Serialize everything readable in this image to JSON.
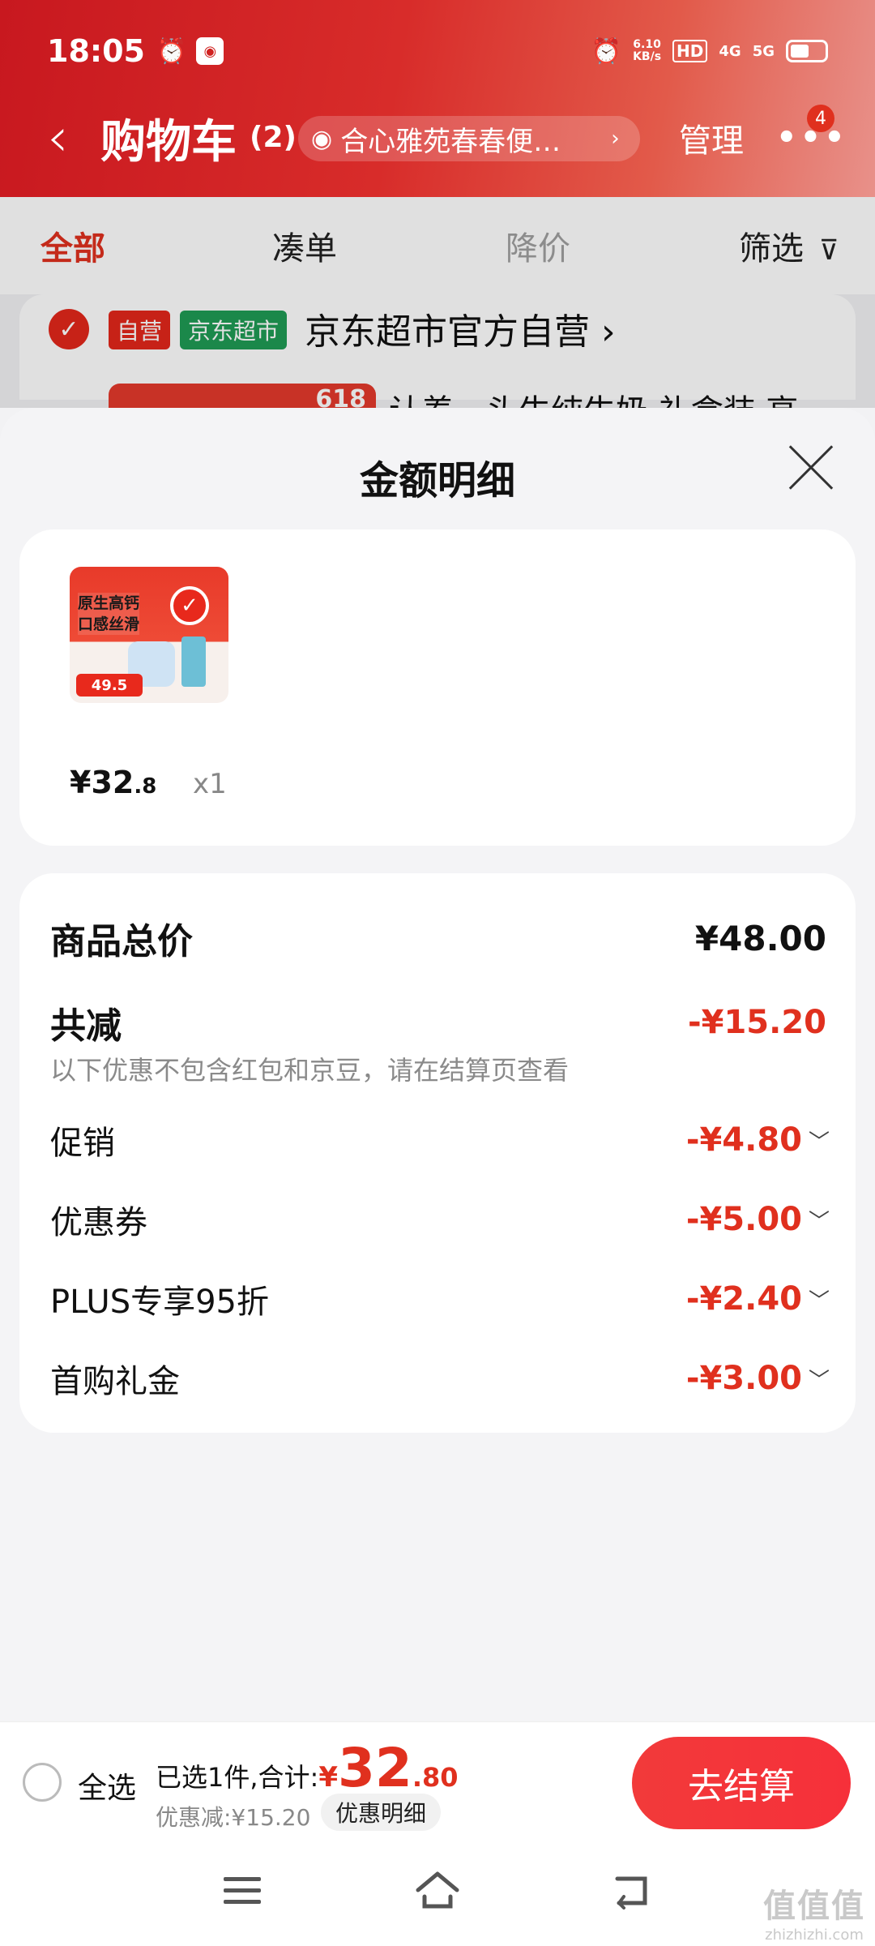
{
  "status_bar": {
    "time": "18:05",
    "net_speed": "6.10",
    "net_unit": "KB/s",
    "hd": "HD",
    "sig1": "4G",
    "sig2": "5G"
  },
  "header": {
    "title": "购物车",
    "count": "(2)",
    "address": "合心雅苑春春便…",
    "manage": "管理",
    "more_badge": "4"
  },
  "tabs": [
    "全部",
    "凑单",
    "降价",
    "筛选"
  ],
  "store": {
    "tag_self": "自营",
    "tag_market": "京东超市",
    "name": "京东超市官方自营",
    "product_title_partial": "认养一头牛纯牛奶 礼盒装 高",
    "product_badge": "618"
  },
  "sheet": {
    "title": "金额明细",
    "item": {
      "thumb_text": "原生高钙\n口感丝滑",
      "thumb_price": "49.5",
      "price_int": "¥32",
      "price_dec": ".8",
      "qty": "x1"
    },
    "total_label": "商品总价",
    "total_value": "¥48.00",
    "reduce_label": "共减",
    "reduce_value": "-¥15.20",
    "reduce_note": "以下优惠不包含红包和京豆，请在结算页查看",
    "discounts": [
      {
        "label": "促销",
        "value": "-¥4.80"
      },
      {
        "label": "优惠券",
        "value": "-¥5.00"
      },
      {
        "label": "PLUS专享95折",
        "value": "-¥2.40"
      },
      {
        "label": "首购礼金",
        "value": "-¥3.00"
      }
    ]
  },
  "bottom_bar": {
    "select_all": "全选",
    "selected_text": "已选1件,合计:",
    "yen": "¥",
    "total_int": "32",
    "total_dec": ".80",
    "discount_text": "优惠减:¥15.20",
    "detail_button": "优惠明细",
    "checkout": "去结算"
  },
  "watermark": {
    "line1": "值值值",
    "line2": "zhizhizhi.com"
  },
  "colors": {
    "accent": "#e0301e",
    "header_red": "#c8181f",
    "market_green": "#1f9b55"
  }
}
